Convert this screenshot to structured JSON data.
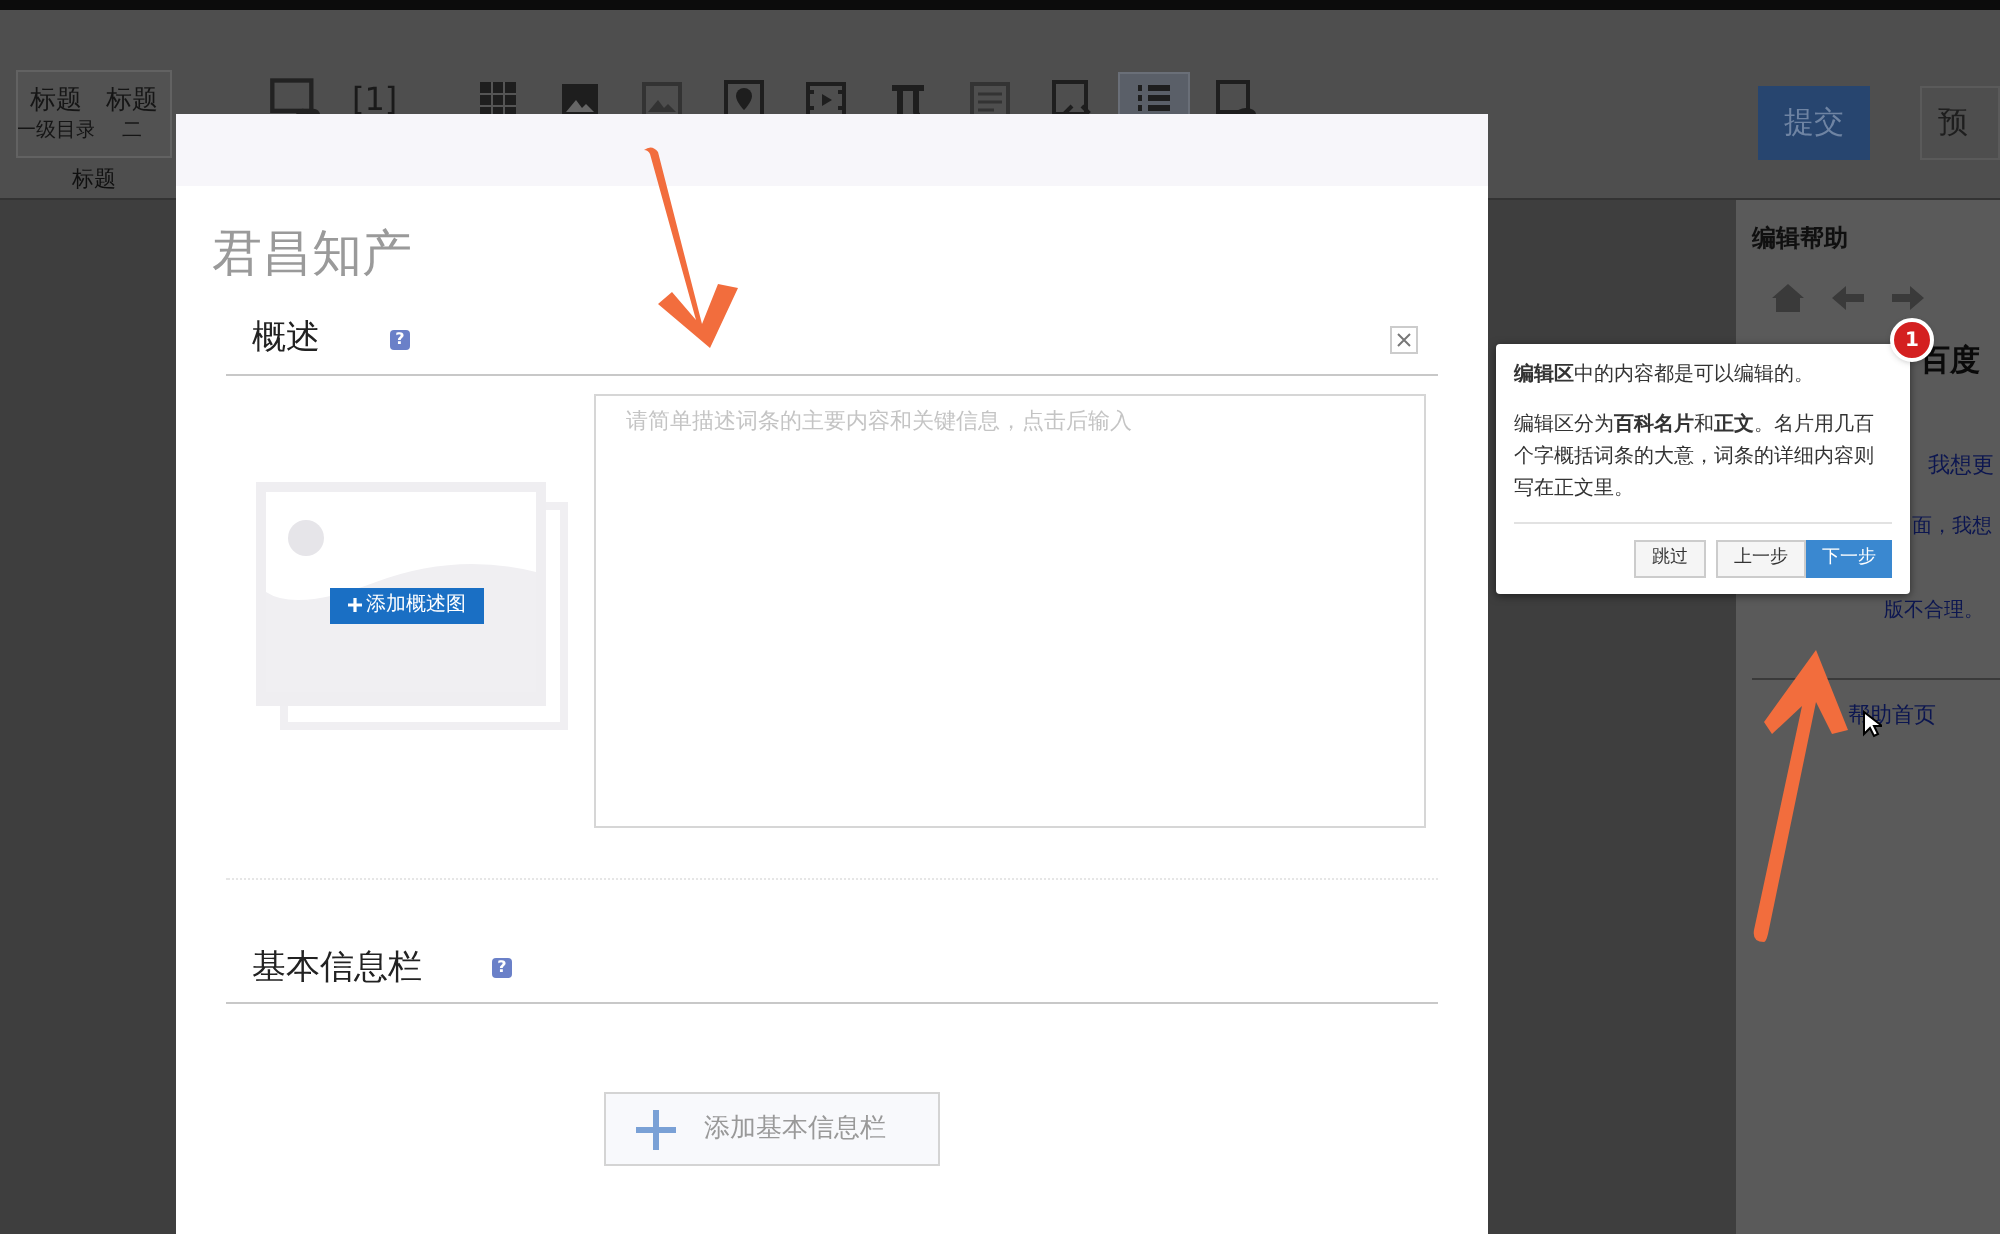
{
  "toolbar": {
    "heading_buttons": [
      {
        "label": "标题",
        "sub": "一级目录"
      },
      {
        "label": "标题",
        "sub": "二"
      }
    ],
    "group_label": "标题",
    "reference": "[1]",
    "tools": [
      {
        "kind": "table",
        "selected": false
      },
      {
        "kind": "image",
        "selected": false
      },
      {
        "kind": "gallery",
        "selected": false
      },
      {
        "kind": "map",
        "selected": false
      },
      {
        "kind": "video",
        "selected": false
      },
      {
        "kind": "formula",
        "selected": false
      },
      {
        "kind": "text",
        "selected": false
      },
      {
        "kind": "code",
        "selected": false
      },
      {
        "kind": "list",
        "selected": true
      },
      {
        "kind": "preview",
        "selected": false
      }
    ],
    "submit": "提交",
    "preview": "预"
  },
  "help": {
    "title": "编辑帮助",
    "heading": "百度",
    "links": [
      "我想更",
      "面，我想",
      "版不合理。"
    ],
    "home": "帮助首页"
  },
  "modal": {
    "title": "君昌知产",
    "sections": [
      {
        "kind": "summary",
        "title": "概述",
        "help_mark": "?",
        "closable": true,
        "placeholder": "请简单描述词条的主要内容和关键信息，点击后输入",
        "image_button": "添加概述图"
      },
      {
        "kind": "infobox",
        "title": "基本信息栏",
        "help_mark": "?",
        "closable": false,
        "add_button": "添加基本信息栏"
      }
    ]
  },
  "tour": {
    "step": "1",
    "paragraphs": [
      "**编辑区**中的内容都是可以编辑的。",
      "编辑区分为**百科名片**和**正文**。名片用几百个字概括词条的大意，词条的详细内容则写在正文里。"
    ],
    "buttons": [
      {
        "label": "跳过",
        "selected": false
      },
      {
        "label": "上一步",
        "selected": false
      },
      {
        "label": "下一步",
        "selected": true
      }
    ]
  }
}
